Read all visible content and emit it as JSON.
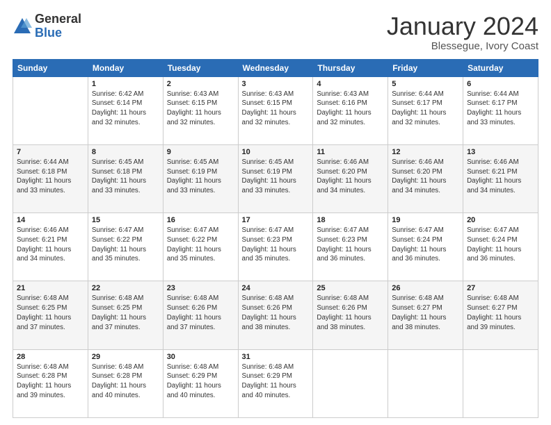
{
  "logo": {
    "general": "General",
    "blue": "Blue"
  },
  "title": {
    "month": "January 2024",
    "location": "Blessegue, Ivory Coast"
  },
  "days_of_week": [
    "Sunday",
    "Monday",
    "Tuesday",
    "Wednesday",
    "Thursday",
    "Friday",
    "Saturday"
  ],
  "weeks": [
    [
      {
        "day": "",
        "info": ""
      },
      {
        "day": "1",
        "info": "Sunrise: 6:42 AM\nSunset: 6:14 PM\nDaylight: 11 hours\nand 32 minutes."
      },
      {
        "day": "2",
        "info": "Sunrise: 6:43 AM\nSunset: 6:15 PM\nDaylight: 11 hours\nand 32 minutes."
      },
      {
        "day": "3",
        "info": "Sunrise: 6:43 AM\nSunset: 6:15 PM\nDaylight: 11 hours\nand 32 minutes."
      },
      {
        "day": "4",
        "info": "Sunrise: 6:43 AM\nSunset: 6:16 PM\nDaylight: 11 hours\nand 32 minutes."
      },
      {
        "day": "5",
        "info": "Sunrise: 6:44 AM\nSunset: 6:17 PM\nDaylight: 11 hours\nand 32 minutes."
      },
      {
        "day": "6",
        "info": "Sunrise: 6:44 AM\nSunset: 6:17 PM\nDaylight: 11 hours\nand 33 minutes."
      }
    ],
    [
      {
        "day": "7",
        "info": "Sunrise: 6:44 AM\nSunset: 6:18 PM\nDaylight: 11 hours\nand 33 minutes."
      },
      {
        "day": "8",
        "info": "Sunrise: 6:45 AM\nSunset: 6:18 PM\nDaylight: 11 hours\nand 33 minutes."
      },
      {
        "day": "9",
        "info": "Sunrise: 6:45 AM\nSunset: 6:19 PM\nDaylight: 11 hours\nand 33 minutes."
      },
      {
        "day": "10",
        "info": "Sunrise: 6:45 AM\nSunset: 6:19 PM\nDaylight: 11 hours\nand 33 minutes."
      },
      {
        "day": "11",
        "info": "Sunrise: 6:46 AM\nSunset: 6:20 PM\nDaylight: 11 hours\nand 34 minutes."
      },
      {
        "day": "12",
        "info": "Sunrise: 6:46 AM\nSunset: 6:20 PM\nDaylight: 11 hours\nand 34 minutes."
      },
      {
        "day": "13",
        "info": "Sunrise: 6:46 AM\nSunset: 6:21 PM\nDaylight: 11 hours\nand 34 minutes."
      }
    ],
    [
      {
        "day": "14",
        "info": "Sunrise: 6:46 AM\nSunset: 6:21 PM\nDaylight: 11 hours\nand 34 minutes."
      },
      {
        "day": "15",
        "info": "Sunrise: 6:47 AM\nSunset: 6:22 PM\nDaylight: 11 hours\nand 35 minutes."
      },
      {
        "day": "16",
        "info": "Sunrise: 6:47 AM\nSunset: 6:22 PM\nDaylight: 11 hours\nand 35 minutes."
      },
      {
        "day": "17",
        "info": "Sunrise: 6:47 AM\nSunset: 6:23 PM\nDaylight: 11 hours\nand 35 minutes."
      },
      {
        "day": "18",
        "info": "Sunrise: 6:47 AM\nSunset: 6:23 PM\nDaylight: 11 hours\nand 36 minutes."
      },
      {
        "day": "19",
        "info": "Sunrise: 6:47 AM\nSunset: 6:24 PM\nDaylight: 11 hours\nand 36 minutes."
      },
      {
        "day": "20",
        "info": "Sunrise: 6:47 AM\nSunset: 6:24 PM\nDaylight: 11 hours\nand 36 minutes."
      }
    ],
    [
      {
        "day": "21",
        "info": "Sunrise: 6:48 AM\nSunset: 6:25 PM\nDaylight: 11 hours\nand 37 minutes."
      },
      {
        "day": "22",
        "info": "Sunrise: 6:48 AM\nSunset: 6:25 PM\nDaylight: 11 hours\nand 37 minutes."
      },
      {
        "day": "23",
        "info": "Sunrise: 6:48 AM\nSunset: 6:26 PM\nDaylight: 11 hours\nand 37 minutes."
      },
      {
        "day": "24",
        "info": "Sunrise: 6:48 AM\nSunset: 6:26 PM\nDaylight: 11 hours\nand 38 minutes."
      },
      {
        "day": "25",
        "info": "Sunrise: 6:48 AM\nSunset: 6:26 PM\nDaylight: 11 hours\nand 38 minutes."
      },
      {
        "day": "26",
        "info": "Sunrise: 6:48 AM\nSunset: 6:27 PM\nDaylight: 11 hours\nand 38 minutes."
      },
      {
        "day": "27",
        "info": "Sunrise: 6:48 AM\nSunset: 6:27 PM\nDaylight: 11 hours\nand 39 minutes."
      }
    ],
    [
      {
        "day": "28",
        "info": "Sunrise: 6:48 AM\nSunset: 6:28 PM\nDaylight: 11 hours\nand 39 minutes."
      },
      {
        "day": "29",
        "info": "Sunrise: 6:48 AM\nSunset: 6:28 PM\nDaylight: 11 hours\nand 40 minutes."
      },
      {
        "day": "30",
        "info": "Sunrise: 6:48 AM\nSunset: 6:29 PM\nDaylight: 11 hours\nand 40 minutes."
      },
      {
        "day": "31",
        "info": "Sunrise: 6:48 AM\nSunset: 6:29 PM\nDaylight: 11 hours\nand 40 minutes."
      },
      {
        "day": "",
        "info": ""
      },
      {
        "day": "",
        "info": ""
      },
      {
        "day": "",
        "info": ""
      }
    ]
  ]
}
